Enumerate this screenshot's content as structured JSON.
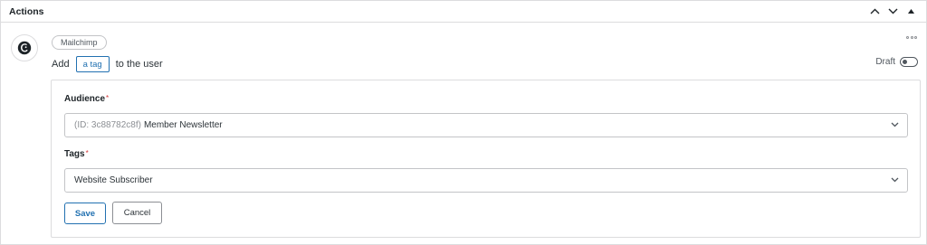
{
  "panel": {
    "title": "Actions",
    "controls": [
      "chevron-up-icon",
      "chevron-down-icon",
      "caret-up-icon"
    ]
  },
  "action": {
    "integration_badge": "Mailchimp",
    "sentence_prefix": "Add",
    "token_label": "a tag",
    "sentence_suffix": "to the user",
    "status_label": "Draft",
    "status_enabled": false,
    "avatar_icon": "mailchimp-logo-icon"
  },
  "form": {
    "audience": {
      "label": "Audience",
      "required_marker": "*",
      "value_prefix": "(ID: 3c88782c8f)",
      "value": "Member Newsletter"
    },
    "tags": {
      "label": "Tags",
      "required_marker": "*",
      "value": "Website Subscriber"
    },
    "save_label": "Save",
    "cancel_label": "Cancel"
  },
  "colors": {
    "accent": "#2271b1",
    "required": "#d63638",
    "border": "#dcdcde"
  }
}
